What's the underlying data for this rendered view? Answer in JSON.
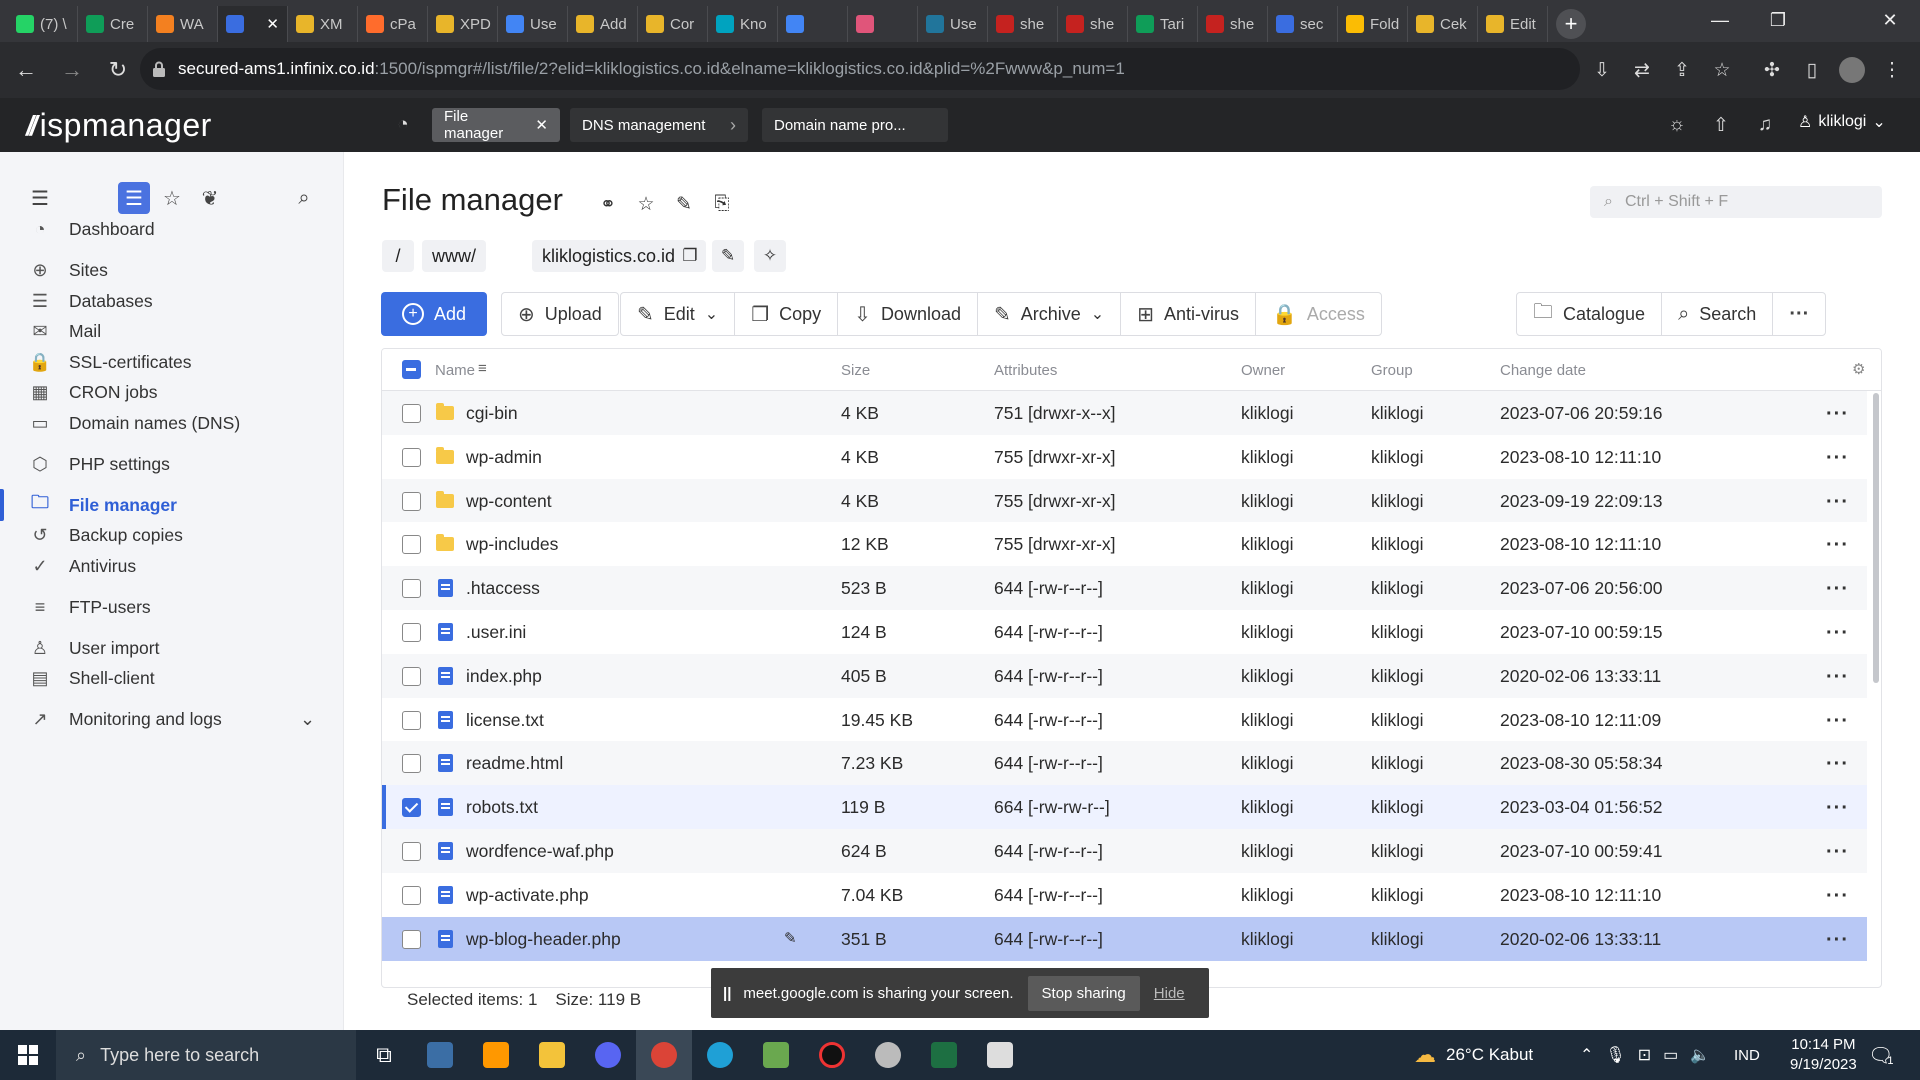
{
  "browser": {
    "tabs": [
      {
        "title": "(7) \\",
        "fav": "whatsapp-icon",
        "color": "#25d366"
      },
      {
        "title": "Cre",
        "fav": "sheets-icon",
        "color": "#0f9d58"
      },
      {
        "title": "WA",
        "fav": "cloud-icon",
        "color": "#f38020"
      },
      {
        "title": "",
        "fav": "ispmanager-icon",
        "color": "#3a6de0",
        "active": true
      },
      {
        "title": "XM",
        "fav": "tab-icon",
        "color": "#e8b52a"
      },
      {
        "title": "cPa",
        "fav": "cpanel-icon",
        "color": "#ff6c2c"
      },
      {
        "title": "XPD",
        "fav": "tab-icon",
        "color": "#e8b52a"
      },
      {
        "title": "Use",
        "fav": "user-icon",
        "color": "#4285f4"
      },
      {
        "title": "Add",
        "fav": "tab-icon",
        "color": "#e8b52a"
      },
      {
        "title": "Cor",
        "fav": "tab-icon",
        "color": "#e8b52a"
      },
      {
        "title": "Kno",
        "fav": "globe-icon",
        "color": "#00a3bf"
      },
      {
        "title": "",
        "fav": "google-icon",
        "color": "#4285f4"
      },
      {
        "title": "",
        "fav": "record-icon",
        "color": "#e0557a"
      },
      {
        "title": "Use",
        "fav": "wordpress-icon",
        "color": "#21759b"
      },
      {
        "title": "she",
        "fav": "pdf-icon",
        "color": "#c5221f"
      },
      {
        "title": "she",
        "fav": "pdf-icon",
        "color": "#c5221f"
      },
      {
        "title": "Tari",
        "fav": "sheets-icon",
        "color": "#0f9d58"
      },
      {
        "title": "she",
        "fav": "pdf-icon",
        "color": "#c5221f"
      },
      {
        "title": "sec",
        "fav": "ispmanager-icon",
        "color": "#3a6de0"
      },
      {
        "title": "Fold",
        "fav": "drive-icon",
        "color": "#fbbc04"
      },
      {
        "title": "Cek",
        "fav": "tab-icon",
        "color": "#e8b52a"
      },
      {
        "title": "Edit",
        "fav": "tab-icon",
        "color": "#e8b52a"
      }
    ],
    "url_host": "secured-ams1.infinix.co.id",
    "url_rest": ":1500/ispmgr#/list/file/2?elid=kliklogistics.co.id&elname=kliklogistics.co.id&plid=%2Fwww&p_num=1"
  },
  "app": {
    "logo": "ispmanager",
    "header_tabs": [
      "File manager",
      "DNS management",
      "Domain name pro..."
    ],
    "user": "kliklogi"
  },
  "sidebar": {
    "items": [
      {
        "label": "Dashboard",
        "icon": "dashboard-icon",
        "glyph": "◔"
      },
      {
        "label": "Sites",
        "icon": "globe-icon",
        "glyph": "⊕"
      },
      {
        "label": "Databases",
        "icon": "database-icon",
        "glyph": "☰"
      },
      {
        "label": "Mail",
        "icon": "mail-icon",
        "glyph": "✉"
      },
      {
        "label": "SSL-certificates",
        "icon": "lock-icon",
        "glyph": "🔒"
      },
      {
        "label": "CRON jobs",
        "icon": "calendar-icon",
        "glyph": "▦"
      },
      {
        "label": "Domain names (DNS)",
        "icon": "dns-icon",
        "glyph": "▭"
      },
      {
        "label": "PHP settings",
        "icon": "php-icon",
        "glyph": "⬡"
      },
      {
        "label": "File manager",
        "icon": "folder-icon",
        "glyph": "🗀",
        "active": true
      },
      {
        "label": "Backup copies",
        "icon": "backup-icon",
        "glyph": "↺"
      },
      {
        "label": "Antivirus",
        "icon": "shield-icon",
        "glyph": "✓"
      },
      {
        "label": "FTP-users",
        "icon": "ftp-icon",
        "glyph": "≡"
      },
      {
        "label": "User import",
        "icon": "user-icon",
        "glyph": "♙"
      },
      {
        "label": "Shell-client",
        "icon": "terminal-icon",
        "glyph": "▤"
      },
      {
        "label": "Monitoring and logs",
        "icon": "chart-icon",
        "glyph": "↗"
      }
    ]
  },
  "main": {
    "title": "File manager",
    "search_placeholder": "Ctrl + Shift + F",
    "breadcrumb": [
      "/",
      "www/",
      "kliklogistics.co.id/"
    ],
    "toolbar": {
      "add": "Add",
      "upload": "Upload",
      "edit": "Edit",
      "copy": "Copy",
      "download": "Download",
      "archive": "Archive",
      "antivirus": "Anti-virus",
      "access": "Access",
      "catalogue": "Catalogue",
      "search": "Search"
    },
    "columns": [
      "Name",
      "Size",
      "Attributes",
      "Owner",
      "Group",
      "Change date"
    ],
    "rows": [
      {
        "name": "cgi-bin",
        "type": "folder",
        "size": "4 KB",
        "attr": "751 [drwxr-x--x]",
        "owner": "kliklogi",
        "group": "kliklogi",
        "date": "2023-07-06 20:59:16"
      },
      {
        "name": "wp-admin",
        "type": "folder",
        "size": "4 KB",
        "attr": "755 [drwxr-xr-x]",
        "owner": "kliklogi",
        "group": "kliklogi",
        "date": "2023-08-10 12:11:10"
      },
      {
        "name": "wp-content",
        "type": "folder",
        "size": "4 KB",
        "attr": "755 [drwxr-xr-x]",
        "owner": "kliklogi",
        "group": "kliklogi",
        "date": "2023-09-19 22:09:13"
      },
      {
        "name": "wp-includes",
        "type": "folder",
        "size": "12 KB",
        "attr": "755 [drwxr-xr-x]",
        "owner": "kliklogi",
        "group": "kliklogi",
        "date": "2023-08-10 12:11:10"
      },
      {
        "name": ".htaccess",
        "type": "file",
        "size": "523 B",
        "attr": "644 [-rw-r--r--]",
        "owner": "kliklogi",
        "group": "kliklogi",
        "date": "2023-07-06 20:56:00"
      },
      {
        "name": ".user.ini",
        "type": "file",
        "size": "124 B",
        "attr": "644 [-rw-r--r--]",
        "owner": "kliklogi",
        "group": "kliklogi",
        "date": "2023-07-10 00:59:15"
      },
      {
        "name": "index.php",
        "type": "file",
        "size": "405 B",
        "attr": "644 [-rw-r--r--]",
        "owner": "kliklogi",
        "group": "kliklogi",
        "date": "2020-02-06 13:33:11"
      },
      {
        "name": "license.txt",
        "type": "file",
        "size": "19.45 KB",
        "attr": "644 [-rw-r--r--]",
        "owner": "kliklogi",
        "group": "kliklogi",
        "date": "2023-08-10 12:11:09"
      },
      {
        "name": "readme.html",
        "type": "file",
        "size": "7.23 KB",
        "attr": "644 [-rw-r--r--]",
        "owner": "kliklogi",
        "group": "kliklogi",
        "date": "2023-08-30 05:58:34"
      },
      {
        "name": "robots.txt",
        "type": "file",
        "size": "119 B",
        "attr": "664 [-rw-rw-r--]",
        "owner": "kliklogi",
        "group": "kliklogi",
        "date": "2023-03-04 01:56:52",
        "selected": true
      },
      {
        "name": "wordfence-waf.php",
        "type": "file",
        "size": "624 B",
        "attr": "644 [-rw-r--r--]",
        "owner": "kliklogi",
        "group": "kliklogi",
        "date": "2023-07-10 00:59:41"
      },
      {
        "name": "wp-activate.php",
        "type": "file",
        "size": "7.04 KB",
        "attr": "644 [-rw-r--r--]",
        "owner": "kliklogi",
        "group": "kliklogi",
        "date": "2023-08-10 12:11:10"
      },
      {
        "name": "wp-blog-header.php",
        "type": "file",
        "size": "351 B",
        "attr": "644 [-rw-r--r--]",
        "owner": "kliklogi",
        "group": "kliklogi",
        "date": "2020-02-06 13:33:11",
        "hovered": true
      }
    ],
    "footer": {
      "selected": "Selected items: 1",
      "size": "Size: 119 B"
    }
  },
  "share_banner": {
    "text": "meet.google.com is sharing your screen.",
    "stop": "Stop sharing",
    "hide": "Hide"
  },
  "taskbar": {
    "search_placeholder": "Type here to search",
    "weather": "26°C  Kabut",
    "lang": "IND",
    "time": "10:14 PM",
    "date": "9/19/2023",
    "notif_count": "1"
  }
}
